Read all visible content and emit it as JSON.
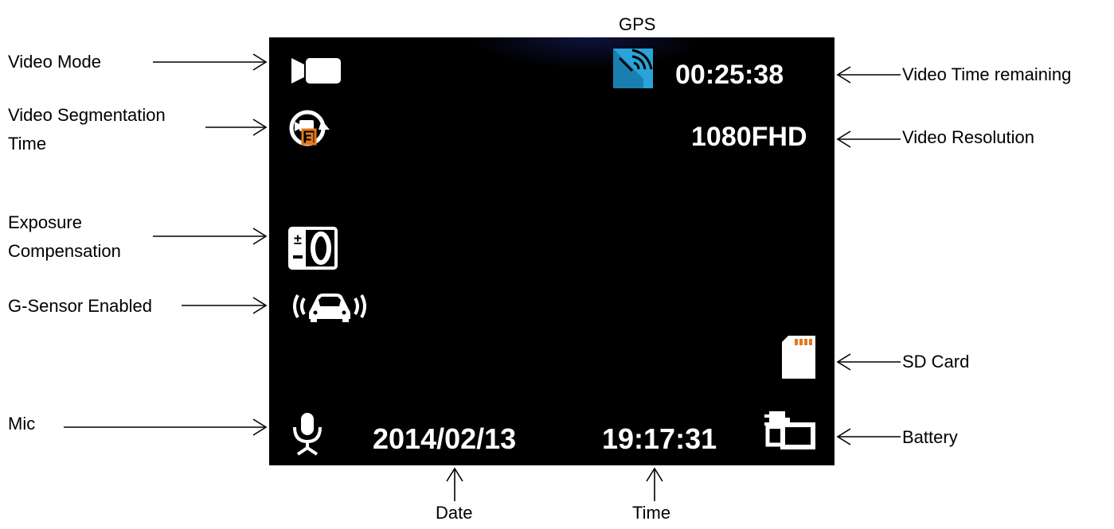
{
  "screen": {
    "video_time_remaining": "00:25:38",
    "resolution": "1080FHD",
    "date": "2014/02/13",
    "time": "19:17:31"
  },
  "callouts": {
    "gps": "GPS",
    "video_mode": "Video Mode",
    "video_segmentation_line1": "Video Segmentation",
    "video_segmentation_line2": "Time",
    "exposure_line1": "Exposure",
    "exposure_line2": "Compensation",
    "g_sensor": "G-Sensor Enabled",
    "mic": "Mic",
    "video_time_remaining": "Video Time remaining",
    "video_resolution": "Video Resolution",
    "sd_card": "SD Card",
    "battery": "Battery",
    "date": "Date",
    "time": "Time"
  },
  "icons": {
    "video_mode": "video-camera-icon",
    "segmentation": "loop-recording-icon",
    "exposure": "exposure-compensation-icon",
    "g_sensor": "g-sensor-car-icon",
    "mic": "microphone-icon",
    "gps": "gps-signal-icon",
    "sd_card": "sd-card-icon",
    "battery": "power-plug-icon"
  },
  "colors": {
    "screen_bg": "#000000",
    "gps_icon": "#2aa3d8",
    "segment_accent": "#e07a1f",
    "osd_text": "#ffffff"
  }
}
